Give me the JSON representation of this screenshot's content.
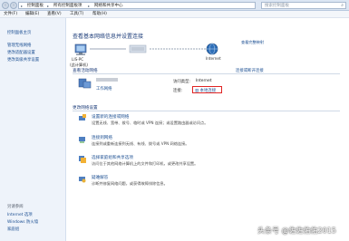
{
  "address_bar": {
    "crumbs": [
      "控制面板",
      "所有控制面板项",
      "网络和共享中心"
    ],
    "search_placeholder": "搜索控制面板"
  },
  "menu": [
    "文件(F)",
    "编辑(E)",
    "查看(V)",
    "工具(T)",
    "帮助(H)"
  ],
  "left_pane": {
    "links": [
      "控制面板主页",
      "管理无线网络",
      "更改适配器设置",
      "更改高级共享设置"
    ],
    "see_also_header": "另请参阅",
    "see_also": [
      "Internet 选项",
      "Windows 防火墙",
      "家庭组"
    ]
  },
  "main": {
    "title": "查看基本网络信息并设置连接",
    "full_map": "查看完整映射",
    "map": {
      "pc_name": "LIS-PC",
      "pc_sub": "(此计算机)",
      "internet": "Internet"
    },
    "active_networks": {
      "header": "查看活动网络",
      "connect_disconnect": "连接或断开连接",
      "network_type": "工作网络",
      "access_type_label": "访问类型:",
      "access_type_value": "Internet",
      "connections_label": "连接:",
      "connections_value": "本地连接"
    },
    "change_settings": {
      "header": "更改网络设置",
      "tasks": [
        {
          "title": "设置新的连接或网络",
          "desc1": "设置无线、宽带、拨号、临时或 VPN 连接；或设置路由器或访问点。",
          "desc2": ""
        },
        {
          "title": "连接到网络",
          "desc1": "连接到或重新连接到无线、有线、拨号或 VPN 网络连接。",
          "desc2": ""
        },
        {
          "title": "选择家庭组和共享选项",
          "desc1": "访问位于其他网络计算机上的文件和打印机，或更改共享设置。",
          "desc2": ""
        },
        {
          "title": "疑难解答",
          "desc1": "诊断并修复网络问题，或获得故障排除信息。",
          "desc2": ""
        }
      ]
    }
  },
  "watermark": "头条号 @佐佐佑佑2015",
  "colors": {
    "link": "#1c4f92",
    "title": "#1d3d7a",
    "highlight": "#e02424",
    "left_bg": "#eef3fa"
  }
}
